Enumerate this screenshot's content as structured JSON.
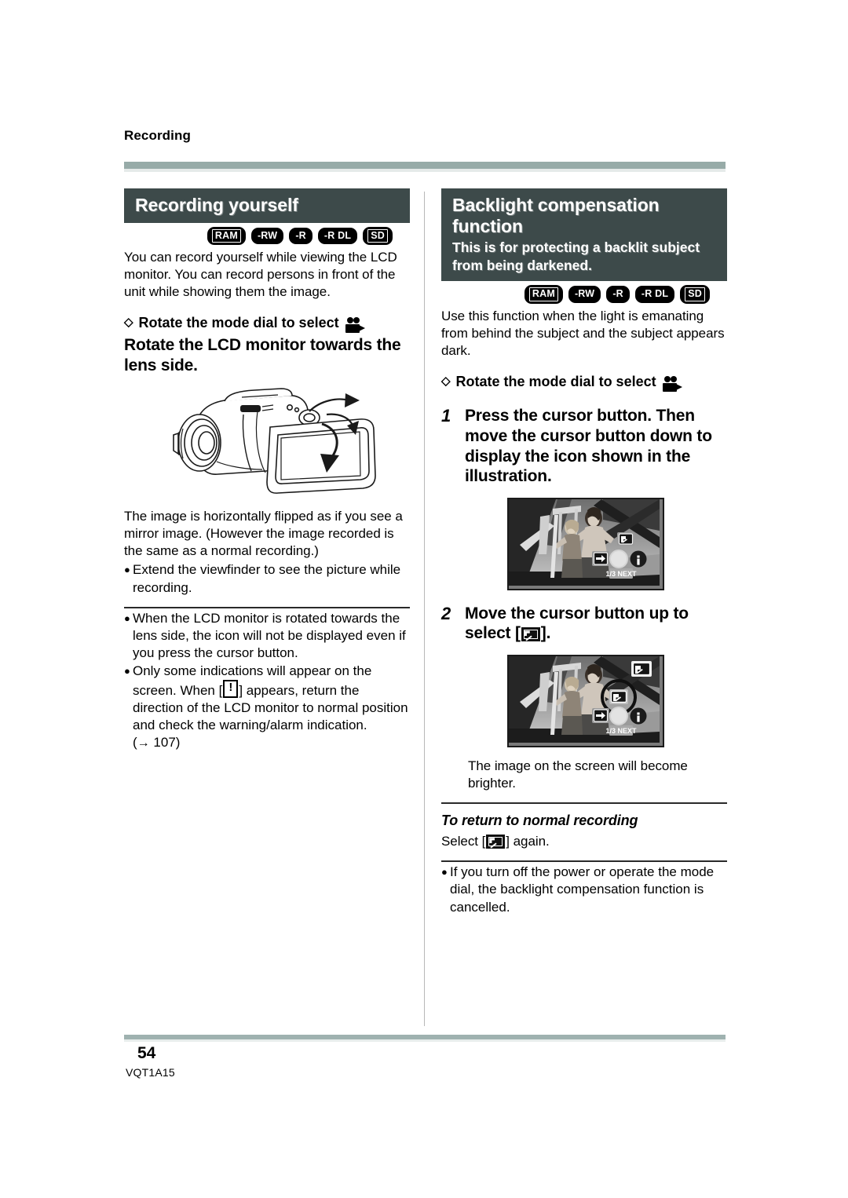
{
  "page": {
    "running_head": "Recording",
    "page_number": "54",
    "doc_code": "VQT1A15",
    "rule_color": "#97aba8",
    "header_bar_color": "#3d4a4a",
    "badge_color": "#000000"
  },
  "badges": [
    "RAM",
    "-RW",
    "-R",
    "-R DL",
    "SD"
  ],
  "left": {
    "section_title": "Recording yourself",
    "intro": "You can record yourself while viewing the LCD monitor. You can record persons in front of the unit while showing them the image.",
    "diamond_heading": "Rotate the mode dial to select",
    "diamond_heading_tail": ".",
    "big_heading": "Rotate the LCD monitor towards the lens side.",
    "illustration_name": "camcorder-lcd-rotate-illustration",
    "after_illustration": "The image is horizontally flipped as if you see a mirror image. (However the image recorded is the same as a normal recording.)",
    "bullets_1": [
      "Extend the viewfinder to see the picture while recording."
    ],
    "bullets_2": [
      {
        "before": "When the LCD monitor is rotated towards the lens side, the icon will not be displayed even if you press the cursor button.",
        "icon": null,
        "after": ""
      },
      {
        "before": "Only some indications will appear on the screen. When [",
        "icon": "warning-icon",
        "after": "] appears, return the direction of the LCD monitor to normal position and check the warning/alarm indication."
      }
    ],
    "page_ref": "107",
    "page_ref_arrow": "→"
  },
  "right": {
    "section_title": "Backlight compensation function",
    "section_subtitle": "This is for protecting a backlit subject from being darkened.",
    "intro": "Use this function when the light is emanating from behind the subject and the subject appears dark.",
    "diamond_heading": "Rotate the mode dial to select",
    "diamond_heading_tail": ".",
    "steps": [
      {
        "number": "1",
        "text": "Press the cursor button. Then move the cursor button down to display the icon shown in the illustration.",
        "illustration_name": "lcd-screen-cursor-icons-illustration"
      },
      {
        "number": "2",
        "text_before": "Move the cursor button up to select [",
        "icon": "backlight-icon",
        "text_after": "].",
        "illustration_name": "lcd-screen-backlight-selected-illustration"
      }
    ],
    "after_step2": "The image on the screen will become brighter.",
    "return_heading": "To return to normal recording",
    "return_text_before": "Select [",
    "return_icon": "backlight-icon",
    "return_text_after": "] again.",
    "final_bullet": "If you turn off the power or operate the mode dial, the backlight compensation function is cancelled."
  },
  "screen_icons": {
    "next_label": "1/3 NEXT",
    "info_label": "i",
    "backlight_label": "backlight-icon",
    "arrow_label": "arrow-right-icon"
  }
}
